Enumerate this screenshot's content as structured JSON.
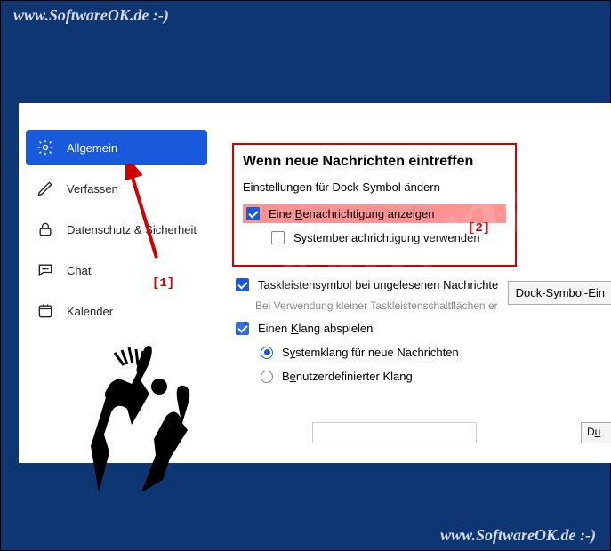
{
  "watermark": "www.SoftwareOK.de :-)",
  "sidebar": {
    "items": [
      {
        "label": "Allgemein",
        "icon": "gear-icon"
      },
      {
        "label": "Verfassen",
        "icon": "pencil-icon"
      },
      {
        "label": "Datenschutz & Sicherheit",
        "icon": "lock-icon"
      },
      {
        "label": "Chat",
        "icon": "chat-icon"
      },
      {
        "label": "Kalender",
        "icon": "calendar-icon"
      }
    ]
  },
  "main": {
    "heading": "Wenn neue Nachrichten eintreffen",
    "subline": "Einstellungen für Dock-Symbol ändern",
    "dockButton": "Dock-Symbol-Ein",
    "cb_notify": "Eine Benachrichtigung anzeigen",
    "cb_sysnotify": "Systembenachrichtigung verwenden",
    "cb_taskbar": "Taskleistensymbol bei ungelesenen Nachrichte",
    "note_taskbar": "Bei Verwendung kleiner Taskleistenschaltflächen er",
    "cb_sound": "Einen Klang abspielen",
    "radio_sys": "Systemklang für neue Nachrichten",
    "radio_custom": "Benutzerdefinierter Klang",
    "du": "Du"
  },
  "markers": {
    "one": "[1]",
    "two": "[2]"
  },
  "ul": {
    "B": "B",
    "K": "K",
    "S": "S",
    "y": "y",
    "e": "e",
    "u": "u"
  }
}
